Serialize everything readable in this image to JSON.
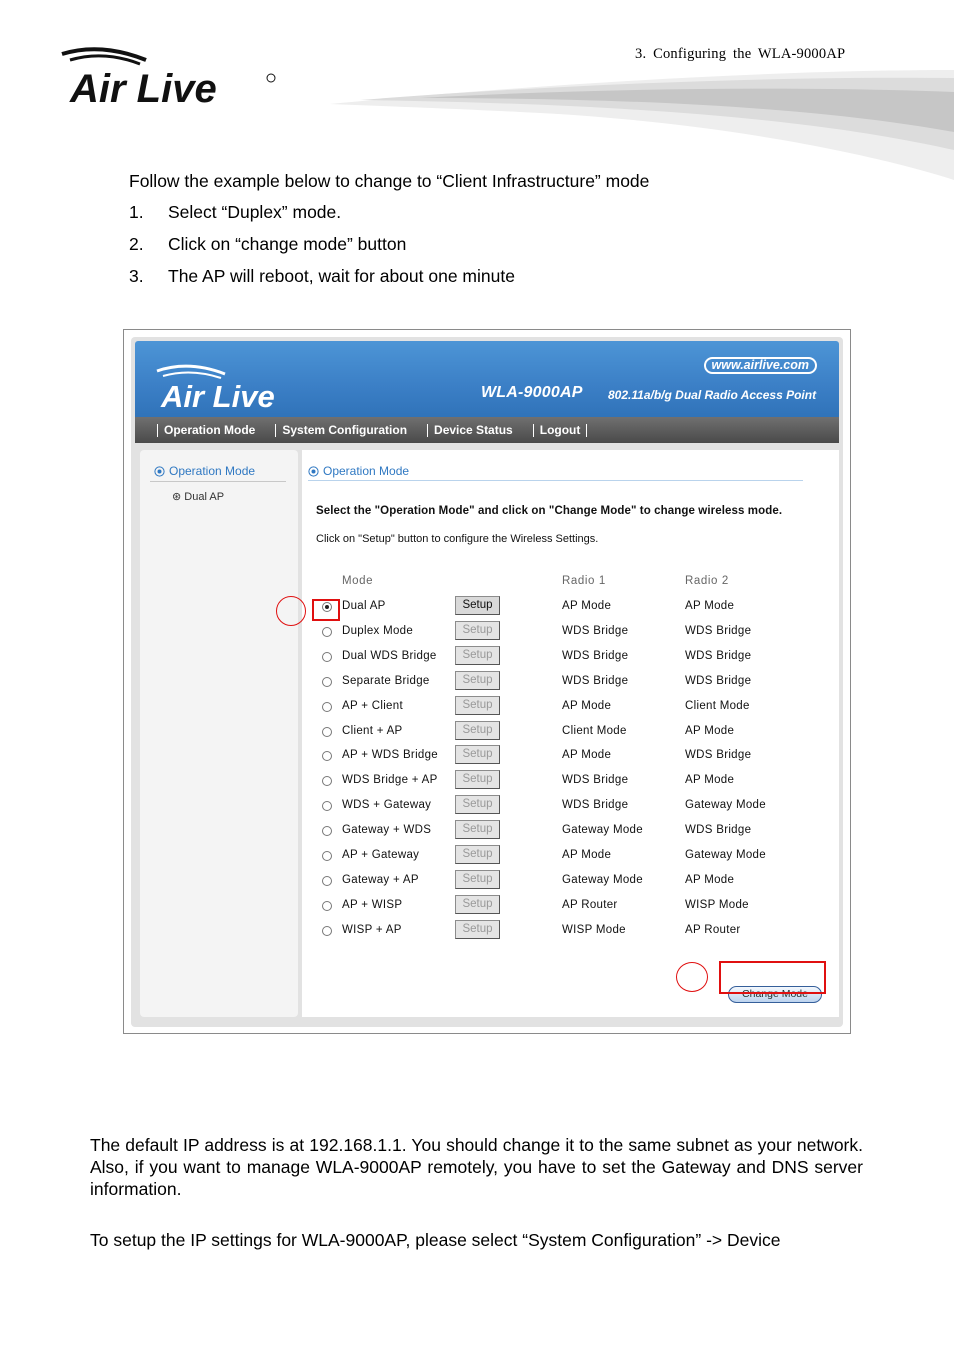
{
  "header": {
    "chapter": "3. Configuring the WLA-9000AP",
    "logo_text": "Air Live"
  },
  "intro": "Follow the example below to change to “Client Infrastructure” mode",
  "steps": [
    {
      "num": "1.",
      "text": "Select “Duplex” mode."
    },
    {
      "num": "2.",
      "text": "Click on “change mode” button"
    },
    {
      "num": "3.",
      "text": "The AP will reboot, wait for about one minute"
    }
  ],
  "screenshot": {
    "url": "www.airlive.com",
    "product": "WLA-9000AP",
    "product_desc": "802.11a/b/g Dual Radio Access Point",
    "nav": [
      "Operation Mode",
      "System Configuration",
      "Device Status",
      "Logout"
    ],
    "sidebar": {
      "title": "Operation Mode",
      "item": "Dual AP"
    },
    "content_title": "Operation Mode",
    "instruction_bold": "Select the \"Operation Mode\" and click on \"Change Mode\" to change wireless mode.",
    "instruction": "Click on \"Setup\" button to configure the Wireless Settings.",
    "columns": {
      "mode": "Mode",
      "radio1": "Radio 1",
      "radio2": "Radio 2"
    },
    "setup_label": "Setup",
    "change_label": "Change Mode",
    "rows": [
      {
        "mode": "Dual AP",
        "r1": "AP Mode",
        "r2": "AP Mode"
      },
      {
        "mode": "Duplex Mode",
        "r1": "WDS Bridge",
        "r2": "WDS Bridge"
      },
      {
        "mode": "Dual WDS Bridge",
        "r1": "WDS Bridge",
        "r2": "WDS Bridge"
      },
      {
        "mode": "Separate Bridge",
        "r1": "WDS Bridge",
        "r2": "WDS Bridge"
      },
      {
        "mode": "AP + Client",
        "r1": "AP Mode",
        "r2": "Client Mode"
      },
      {
        "mode": "Client + AP",
        "r1": "Client Mode",
        "r2": "AP Mode"
      },
      {
        "mode": "AP + WDS Bridge",
        "r1": "AP Mode",
        "r2": "WDS Bridge"
      },
      {
        "mode": "WDS Bridge + AP",
        "r1": "WDS Bridge",
        "r2": "AP Mode"
      },
      {
        "mode": "WDS + Gateway",
        "r1": "WDS Bridge",
        "r2": "Gateway Mode"
      },
      {
        "mode": "Gateway +  WDS",
        "r1": "Gateway Mode",
        "r2": "WDS Bridge"
      },
      {
        "mode": "AP + Gateway",
        "r1": "AP Mode",
        "r2": "Gateway Mode"
      },
      {
        "mode": "Gateway  + AP",
        "r1": "Gateway Mode",
        "r2": "AP Mode"
      },
      {
        "mode": "AP + WISP",
        "r1": "AP Router",
        "r2": "WISP Mode"
      },
      {
        "mode": "WISP + AP",
        "r1": "WISP Mode",
        "r2": "AP Router"
      }
    ]
  },
  "para1": "The default IP address is at 192.168.1.1.  You should change it to the same subnet as your network.  Also, if you want to manage WLA-9000AP remotely, you have to set the Gateway and DNS server information.",
  "para2": "To setup the IP settings for WLA-9000AP, please select “System Configuration” -> Device",
  "colors": {
    "accent": "#2f78c2",
    "banner": "#3b7fc6",
    "callout": "#e01010"
  }
}
